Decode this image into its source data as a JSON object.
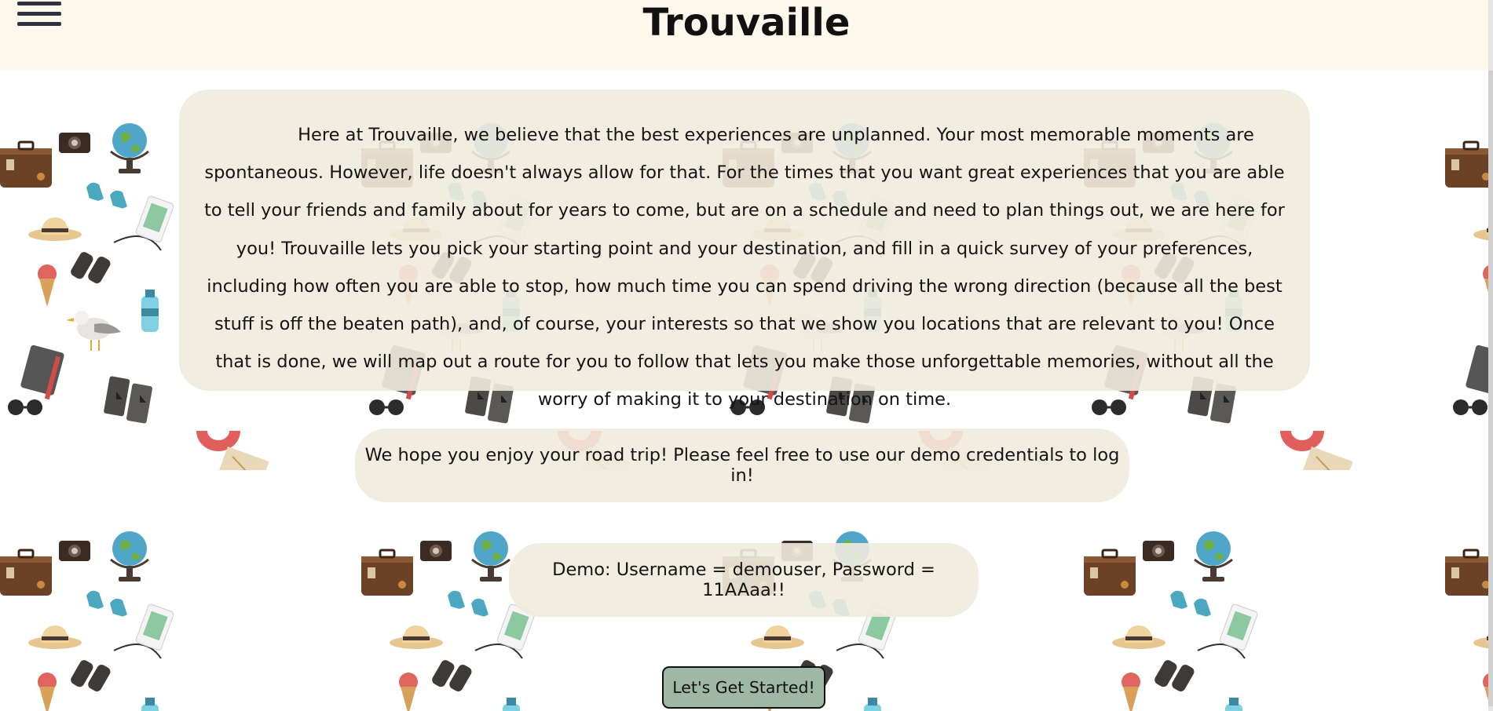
{
  "header": {
    "title": "Trouvaille",
    "menu_icon": "hamburger-menu-icon",
    "background": "#fdf8ec"
  },
  "intro": {
    "text": "Here at Trouvaille, we believe that the best experiences are unplanned. Your most memorable moments are spontaneous. However, life doesn't always allow for that. For the times that you want great experiences that you are able to tell your friends and family about for years to come, but are on a schedule and need to plan things out, we are here for you! Trouvaille lets you pick your starting point and your destination, and fill in a quick survey of your preferences, including how often you are able to stop, how much time you can spend driving the wrong direction (because all the best stuff is off the beaten path), and, of course, your interests so that we show you locations that are relevant to you! Once that is done, we will map out a route for you to follow that lets you make those unforgettable memories, without all the worry of making it to your destination on time."
  },
  "enjoy": {
    "text": "We hope you enjoy your road trip! Please feel free to use our demo credentials to log in!"
  },
  "demo": {
    "text": "Demo: Username = demouser, Password = 11AAaa!!"
  },
  "start_button": {
    "label": "Let's Get Started!",
    "color": "#9fb8a6"
  },
  "background_pattern": {
    "icons": [
      "suitcase-icon",
      "globe-icon",
      "camera-icon",
      "sneakers-icon",
      "hat-icon",
      "binoculars-icon",
      "ice-cream-icon",
      "water-bottle-icon",
      "seagull-icon",
      "notebook-icon",
      "passport-icon",
      "paper-plane-icon",
      "signpost-icon",
      "coffee-cup-icon",
      "map-icon",
      "backpack-icon",
      "sunglasses-icon",
      "neck-pillow-icon",
      "postcard-icon",
      "ticket-icon",
      "paper-boat-icon",
      "photo-icon"
    ]
  }
}
